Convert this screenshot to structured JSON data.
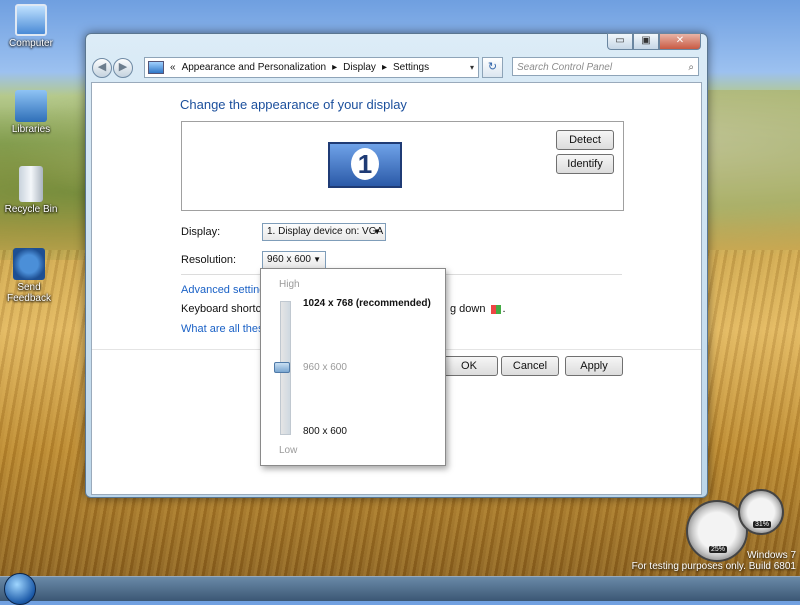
{
  "desktop": {
    "icons": [
      {
        "label": "Computer",
        "icon": "computer-icon"
      },
      {
        "label": "Libraries",
        "icon": "libraries-icon"
      },
      {
        "label": "Recycle Bin",
        "icon": "recycle-bin-icon"
      },
      {
        "label": "Send Feedback",
        "icon": "feedback-icon"
      }
    ],
    "watermark": {
      "line1": "Windows 7",
      "line2": "For testing purposes only. Build 6801"
    },
    "gadget": {
      "cpu": "25%",
      "mem": "31%"
    }
  },
  "window": {
    "caption": {
      "min": "▭",
      "max": "▣",
      "close": "✕"
    },
    "nav": {
      "back": "◀",
      "forward": "▶"
    },
    "breadcrumb": {
      "prefix": "«",
      "items": [
        "Appearance and Personalization",
        "Display",
        "Settings"
      ],
      "sep": "▸",
      "dropdown": "▾"
    },
    "refresh": "↻",
    "search": {
      "placeholder": "Search Control Panel",
      "icon": "search-icon"
    },
    "title": "Change the appearance of your display",
    "monitor_number": "1",
    "detect_label": "Detect",
    "identify_label": "Identify",
    "display_label": "Display:",
    "display_value": "1. Display device on: VGA",
    "resolution_label": "Resolution:",
    "resolution_value": "960 x 600",
    "advanced_link": "Advanced settings...",
    "keyboard_text_start": "Keyboard shortcut t",
    "keyboard_text_end": "g down",
    "keyboard_text_dot": ".",
    "what_link": "What are all these o",
    "ok_label": "OK",
    "cancel_label": "Cancel",
    "apply_label": "Apply"
  },
  "resolution_popup": {
    "high": "High",
    "low": "Low",
    "options": [
      "1024 x 768 (recommended)",
      "960 x 600",
      "800 x 600"
    ],
    "selected_index": 1
  }
}
